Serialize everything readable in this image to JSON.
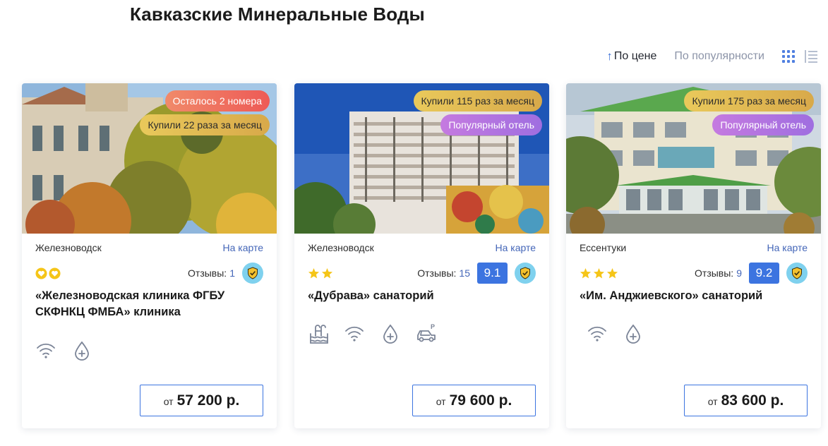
{
  "page": {
    "title": "Кавказские Минеральные Воды"
  },
  "sort": {
    "by_price": "По цене",
    "by_popularity": "По популярности"
  },
  "colors": {
    "accent": "#3c74e0",
    "link": "#4466b8",
    "score_bg": "#3c74e0",
    "shield_bg": "#7fd1ee",
    "star": "#f5c518"
  },
  "hotels": [
    {
      "badges": [
        "Осталось 2 номера",
        "Купили 22 раза за месяц"
      ],
      "city": "Железноводск",
      "map_link": "На карте",
      "rating_icon": "heart-icon",
      "rating_count": 2,
      "reviews_label": "Отзывы:",
      "reviews_count": "1",
      "score": "",
      "name": "«Железноводская клиника ФГБУ СКФНКЦ ФМБА» клиника",
      "amenities": [
        "wifi-icon",
        "medical-drop-icon"
      ],
      "price_prefix": "от",
      "price": "57 200 р."
    },
    {
      "badges": [
        "Купили 115 раз за месяц",
        "Популярный отель"
      ],
      "city": "Железноводск",
      "map_link": "На карте",
      "rating_icon": "star-icon",
      "rating_count": 2,
      "reviews_label": "Отзывы:",
      "reviews_count": "15",
      "score": "9.1",
      "name": "«Дубрава» санаторий",
      "amenities": [
        "pool-icon",
        "wifi-icon",
        "medical-drop-icon",
        "parking-icon"
      ],
      "price_prefix": "от",
      "price": "79 600 р."
    },
    {
      "badges": [
        "Купили 175 раз за месяц",
        "Популярный отель"
      ],
      "city": "Ессентуки",
      "map_link": "На карте",
      "rating_icon": "star-icon",
      "rating_count": 3,
      "reviews_label": "Отзывы:",
      "reviews_count": "9",
      "score": "9.2",
      "name": "«Им. Анджиевского» санаторий",
      "amenities": [
        "wifi-icon",
        "medical-drop-icon"
      ],
      "price_prefix": "от",
      "price": "83 600 р."
    }
  ]
}
